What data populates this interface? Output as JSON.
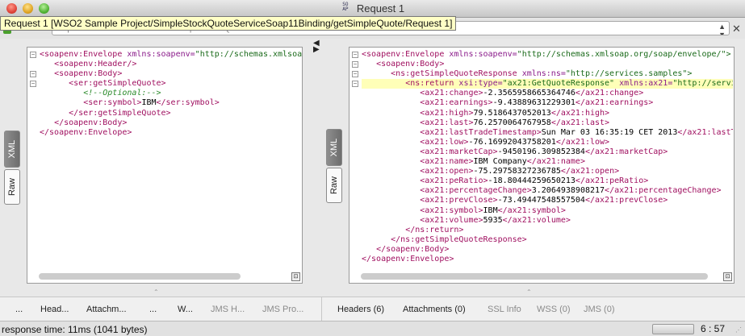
{
  "window": {
    "title": "Request 1"
  },
  "tooltip": "Request 1 [WSO2 Sample Project/SimpleStockQuoteServiceSoap11Binding/getSimpleQuote/Request 1]",
  "endpoint": {
    "value": "http://localhost:8280/services/SimpleStockQuoteService"
  },
  "request_panel": {
    "tabs": {
      "xml": "XML",
      "raw": "Raw"
    },
    "lines": [
      [
        [
          "tag",
          "<soapenv:Envelope "
        ],
        [
          "attr",
          "xmlns:soapenv="
        ],
        [
          "val",
          "\"http://schemas.xmlsoap.org/soap/envelope/\" "
        ],
        [
          "attr",
          "xmlns:ser="
        ],
        [
          "val",
          "\"http://services.samples\">"
        ]
      ],
      [
        [
          "txt",
          "   "
        ],
        [
          "tag",
          "<soapenv:Header/>"
        ]
      ],
      [
        [
          "txt",
          "   "
        ],
        [
          "tag",
          "<soapenv:Body>"
        ]
      ],
      [
        [
          "txt",
          "      "
        ],
        [
          "tag",
          "<ser:getSimpleQuote>"
        ]
      ],
      [
        [
          "txt",
          "         "
        ],
        [
          "cmt",
          "<!--Optional:-->"
        ]
      ],
      [
        [
          "txt",
          "         "
        ],
        [
          "tag",
          "<ser:symbol>"
        ],
        [
          "txt",
          "IBM"
        ],
        [
          "tag",
          "</ser:symbol>"
        ]
      ],
      [
        [
          "txt",
          "      "
        ],
        [
          "tag",
          "</ser:getSimpleQuote>"
        ]
      ],
      [
        [
          "txt",
          "   "
        ],
        [
          "tag",
          "</soapenv:Body>"
        ]
      ],
      [
        [
          "tag",
          "</soapenv:Envelope>"
        ]
      ]
    ]
  },
  "response_panel": {
    "tabs": {
      "xml": "XML",
      "raw": "Raw"
    },
    "highlight_line": 4,
    "lines": [
      [
        [
          "tag",
          "<soapenv:Envelope "
        ],
        [
          "attr",
          "xmlns:soapenv="
        ],
        [
          "val",
          "\"http://schemas.xmlsoap.org/soap/envelope/\">"
        ]
      ],
      [
        [
          "txt",
          "   "
        ],
        [
          "tag",
          "<soapenv:Body>"
        ]
      ],
      [
        [
          "txt",
          "      "
        ],
        [
          "tag",
          "<ns:getSimpleQuoteResponse "
        ],
        [
          "attr",
          "xmlns:ns="
        ],
        [
          "val",
          "\"http://services.samples\">"
        ]
      ],
      [
        [
          "txt",
          "         "
        ],
        [
          "tag",
          "<ns:return "
        ],
        [
          "attr",
          "xsi:type="
        ],
        [
          "val",
          "\"ax21:GetQuoteResponse\" "
        ],
        [
          "attr",
          "xmlns:ax21="
        ],
        [
          "val",
          "\"http://services.samples/xsd\">"
        ]
      ],
      [
        [
          "txt",
          "            "
        ],
        [
          "tag",
          "<ax21:change>"
        ],
        [
          "txt",
          "-2.3565958665364746"
        ],
        [
          "tag",
          "</ax21:change>"
        ]
      ],
      [
        [
          "txt",
          "            "
        ],
        [
          "tag",
          "<ax21:earnings>"
        ],
        [
          "txt",
          "-9.43889631229301"
        ],
        [
          "tag",
          "</ax21:earnings>"
        ]
      ],
      [
        [
          "txt",
          "            "
        ],
        [
          "tag",
          "<ax21:high>"
        ],
        [
          "txt",
          "79.5186437052013"
        ],
        [
          "tag",
          "</ax21:high>"
        ]
      ],
      [
        [
          "txt",
          "            "
        ],
        [
          "tag",
          "<ax21:last>"
        ],
        [
          "txt",
          "76.2570064767958"
        ],
        [
          "tag",
          "</ax21:last>"
        ]
      ],
      [
        [
          "txt",
          "            "
        ],
        [
          "tag",
          "<ax21:lastTradeTimestamp>"
        ],
        [
          "txt",
          "Sun Mar 03 16:35:19 CET 2013"
        ],
        [
          "tag",
          "</ax21:lastTradeTimestamp>"
        ]
      ],
      [
        [
          "txt",
          "            "
        ],
        [
          "tag",
          "<ax21:low>"
        ],
        [
          "txt",
          "-76.16992043758201"
        ],
        [
          "tag",
          "</ax21:low>"
        ]
      ],
      [
        [
          "txt",
          "            "
        ],
        [
          "tag",
          "<ax21:marketCap>"
        ],
        [
          "txt",
          "-9450196.309852384"
        ],
        [
          "tag",
          "</ax21:marketCap>"
        ]
      ],
      [
        [
          "txt",
          "            "
        ],
        [
          "tag",
          "<ax21:name>"
        ],
        [
          "txt",
          "IBM Company"
        ],
        [
          "tag",
          "</ax21:name>"
        ]
      ],
      [
        [
          "txt",
          "            "
        ],
        [
          "tag",
          "<ax21:open>"
        ],
        [
          "txt",
          "-75.29758327236785"
        ],
        [
          "tag",
          "</ax21:open>"
        ]
      ],
      [
        [
          "txt",
          "            "
        ],
        [
          "tag",
          "<ax21:peRatio>"
        ],
        [
          "txt",
          "-18.80444259650213"
        ],
        [
          "tag",
          "</ax21:peRatio>"
        ]
      ],
      [
        [
          "txt",
          "            "
        ],
        [
          "tag",
          "<ax21:percentageChange>"
        ],
        [
          "txt",
          "3.2064938908217"
        ],
        [
          "tag",
          "</ax21:percentageChange>"
        ]
      ],
      [
        [
          "txt",
          "            "
        ],
        [
          "tag",
          "<ax21:prevClose>"
        ],
        [
          "txt",
          "-73.49447548557504"
        ],
        [
          "tag",
          "</ax21:prevClose>"
        ]
      ],
      [
        [
          "txt",
          "            "
        ],
        [
          "tag",
          "<ax21:symbol>"
        ],
        [
          "txt",
          "IBM"
        ],
        [
          "tag",
          "</ax21:symbol>"
        ]
      ],
      [
        [
          "txt",
          "            "
        ],
        [
          "tag",
          "<ax21:volume>"
        ],
        [
          "txt",
          "5935"
        ],
        [
          "tag",
          "</ax21:volume>"
        ]
      ],
      [
        [
          "txt",
          "         "
        ],
        [
          "tag",
          "</ns:return>"
        ]
      ],
      [
        [
          "txt",
          "      "
        ],
        [
          "tag",
          "</ns:getSimpleQuoteResponse>"
        ]
      ],
      [
        [
          "txt",
          "   "
        ],
        [
          "tag",
          "</soapenv:Body>"
        ]
      ],
      [
        [
          "tag",
          "</soapenv:Envelope>"
        ]
      ]
    ]
  },
  "request_tabs": [
    "...",
    "Head...",
    "Attachm...",
    "...",
    "W...",
    "JMS H...",
    "JMS Pro..."
  ],
  "response_tabs": [
    "Headers (6)",
    "Attachments (0)",
    "SSL Info",
    "WSS (0)",
    "JMS (0)"
  ],
  "status": {
    "response_time": "response time: 11ms (1041 bytes)",
    "caret": "6 : 57"
  }
}
